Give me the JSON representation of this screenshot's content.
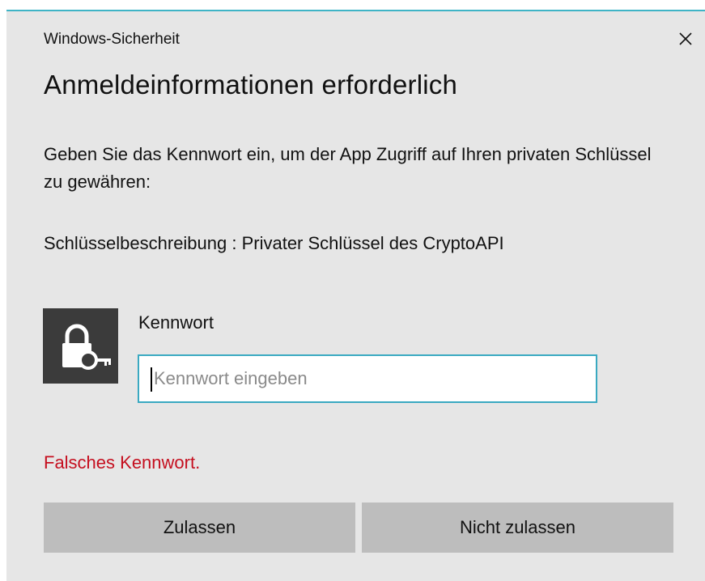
{
  "dialog": {
    "window_title": "Windows-Sicherheit",
    "heading": "Anmeldeinformationen erforderlich",
    "description": "Geben Sie das Kennwort ein, um der App Zugriff auf Ihren privaten Schlüssel zu gewähren:",
    "key_description": "Schlüsselbeschreibung  : Privater Schlüssel des CryptoAPI",
    "password_label": "Kennwort",
    "password_placeholder": "Kennwort eingeben",
    "password_value": "",
    "error_message": "Falsches Kennwort.",
    "allow_button": "Zulassen",
    "deny_button": "Nicht zulassen",
    "close_icon": "close-icon",
    "lock_icon": "lock-key-icon"
  },
  "colors": {
    "dialog_background": "#e6e6e6",
    "accent_border": "#3fb4c6",
    "input_border": "#3aa9c1",
    "error": "#c50f1f",
    "button_background": "#bdbdbd",
    "icon_tile": "#3b3b3b"
  }
}
